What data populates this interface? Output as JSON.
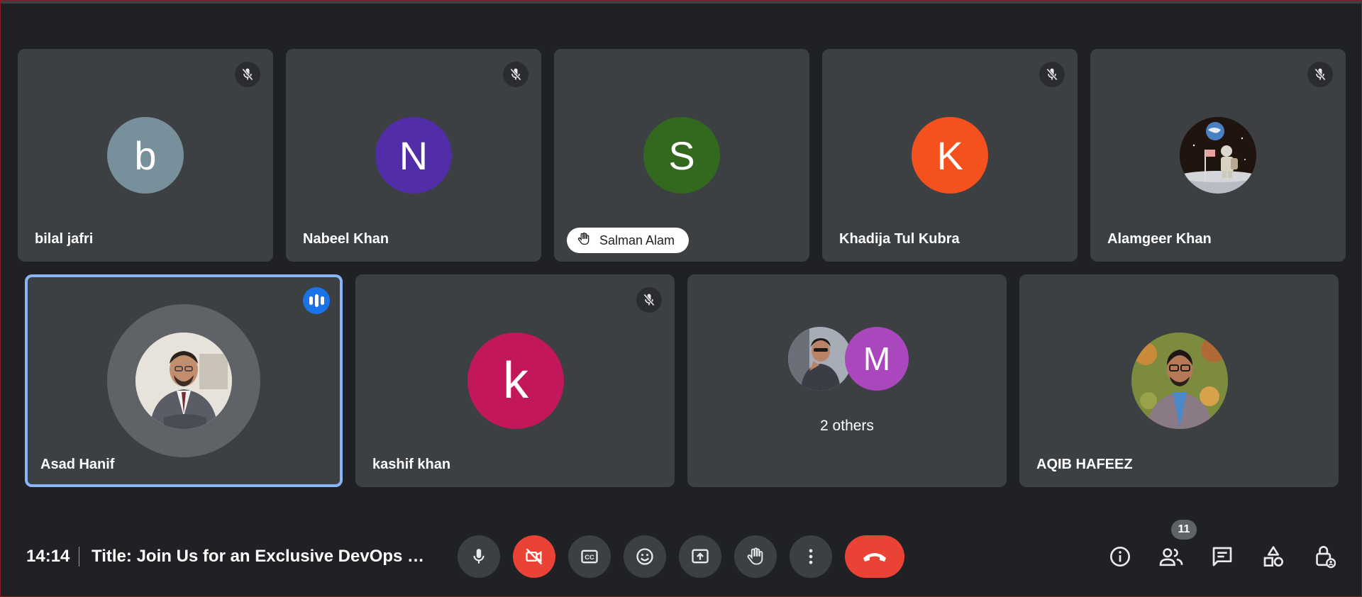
{
  "participants_row1": [
    {
      "name": "bilal jafri",
      "initial": "b",
      "color": "#78909c",
      "muted": true
    },
    {
      "name": "Nabeel Khan",
      "initial": "N",
      "color": "#512da8",
      "muted": true
    },
    {
      "name": "Salman Alam",
      "initial": "S",
      "color": "#33691e",
      "muted": false,
      "hand_raised": true
    },
    {
      "name": "Khadija Tul Kubra",
      "initial": "K",
      "color": "#f4511e",
      "muted": true
    },
    {
      "name": "Alamgeer Khan",
      "initial": "",
      "color": "#3e2723",
      "muted": true,
      "avatar_icon": "astronaut-photo"
    }
  ],
  "participants_row2": [
    {
      "name": "Asad Hanif",
      "avatar_icon": "profile-photo",
      "speaking": true
    },
    {
      "name": "kashif khan",
      "initial": "k",
      "color": "#c2185b",
      "muted": true
    },
    {
      "others_label": "2 others",
      "second_initial": "M",
      "second_color": "#ab47bc"
    },
    {
      "name": "AQIB HAFEEZ",
      "avatar_icon": "profile-photo"
    }
  ],
  "meeting": {
    "time": "14:14",
    "title": "Title: Join Us for an Exclusive DevOps Dis..."
  },
  "people_count": "11",
  "colors": {
    "background": "#202124",
    "tile": "#3c4043",
    "danger": "#ea4335",
    "speaking": "#1a73e8",
    "active_border": "#8ab4f8"
  },
  "controls": [
    "mic-icon",
    "camera-off-icon",
    "captions-icon",
    "emoji-icon",
    "present-icon",
    "raise-hand-icon",
    "more-options-icon",
    "end-call-icon"
  ],
  "right_controls": [
    "info-icon",
    "people-icon",
    "chat-icon",
    "activities-icon",
    "host-controls-icon"
  ]
}
